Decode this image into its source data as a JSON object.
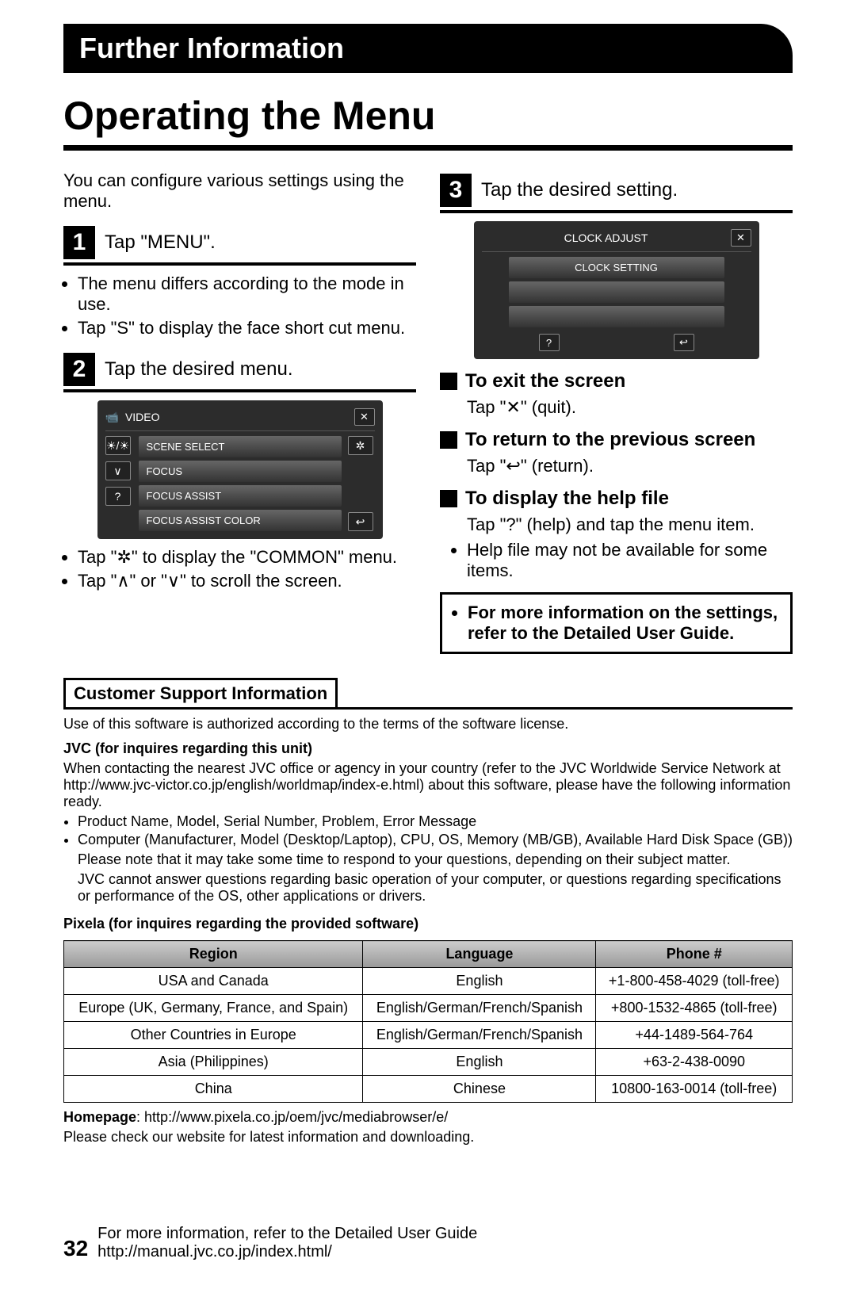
{
  "header": "Further Information",
  "title": "Operating the Menu",
  "intro": "You can configure various settings using the menu.",
  "step1": {
    "num": "1",
    "text": "Tap \"MENU\".",
    "bullets": [
      "The menu differs according to the mode in use.",
      "Tap \"S\" to display the face short cut menu."
    ]
  },
  "step2": {
    "num": "2",
    "text": "Tap the desired menu.",
    "screen": {
      "header_label": "VIDEO",
      "items": [
        "SCENE SELECT",
        "FOCUS",
        "FOCUS ASSIST",
        "FOCUS ASSIST COLOR"
      ]
    },
    "bullets": [
      "Tap \"✲\" to display the \"COMMON\" menu.",
      "Tap \"∧\" or \"∨\" to scroll the screen."
    ]
  },
  "step3": {
    "num": "3",
    "text": "Tap the desired setting.",
    "screen": {
      "header_label": "CLOCK ADJUST",
      "items": [
        "CLOCK SETTING",
        "",
        ""
      ]
    }
  },
  "sections": [
    {
      "heading": "To exit the screen",
      "detail": "Tap \"✕\" (quit)."
    },
    {
      "heading": "To return to the previous screen",
      "detail": "Tap \"↩\" (return)."
    },
    {
      "heading": "To display the help file",
      "detail": "Tap \"?\" (help) and tap the menu item.",
      "bullets": [
        "Help file may not be available for some items."
      ]
    }
  ],
  "note": "For more information on the settings, refer to the Detailed User Guide.",
  "support": {
    "header": "Customer Support Information",
    "license": "Use of this software is authorized according to the terms of the software license.",
    "jvc_heading": "JVC (for inquires regarding this unit)",
    "jvc_contact": "When contacting the nearest JVC office or agency in your country (refer to the JVC Worldwide Service Network at http://www.jvc-victor.co.jp/english/worldmap/index-e.html) about this software, please have the following information ready.",
    "jvc_list": [
      "Product Name, Model, Serial Number, Problem, Error Message",
      "Computer (Manufacturer, Model (Desktop/Laptop), CPU, OS, Memory (MB/GB), Available Hard Disk Space (GB))"
    ],
    "jvc_note1": "Please note that it may take some time to respond to your questions, depending on their subject matter.",
    "jvc_note2": "JVC cannot answer questions regarding basic operation of your computer, or questions regarding specifications or performance of the OS, other applications or drivers.",
    "pixela_heading": "Pixela (for inquires regarding the provided software)",
    "table": {
      "headers": [
        "Region",
        "Language",
        "Phone #"
      ],
      "rows": [
        [
          "USA and Canada",
          "English",
          "+1-800-458-4029 (toll-free)"
        ],
        [
          "Europe (UK, Germany, France, and Spain)",
          "English/German/French/Spanish",
          "+800-1532-4865 (toll-free)"
        ],
        [
          "Other Countries in Europe",
          "English/German/French/Spanish",
          "+44-1489-564-764"
        ],
        [
          "Asia (Philippines)",
          "English",
          "+63-2-438-0090"
        ],
        [
          "China",
          "Chinese",
          "10800-163-0014 (toll-free)"
        ]
      ]
    },
    "homepage_label": "Homepage",
    "homepage_url": "http://www.pixela.co.jp/oem/jvc/mediabrowser/e/",
    "homepage_note": "Please check our website for latest information and downloading."
  },
  "footer": {
    "page_num": "32",
    "line1": "For more information, refer to the Detailed User Guide",
    "line2": "http://manual.jvc.co.jp/index.html/"
  }
}
